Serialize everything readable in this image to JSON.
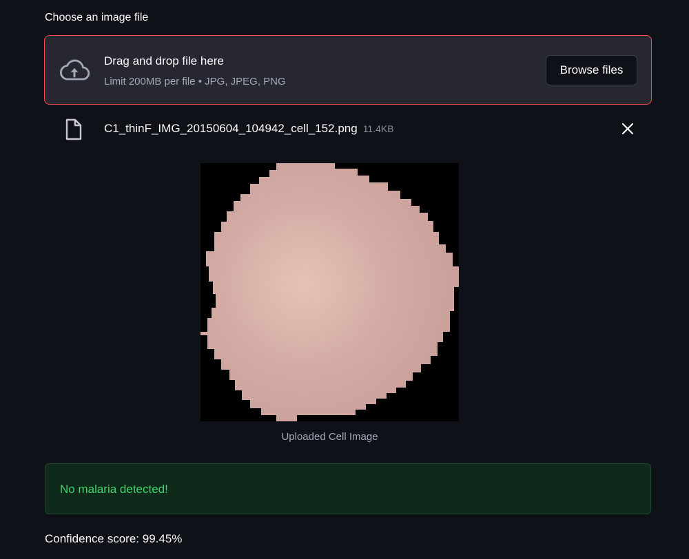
{
  "uploader": {
    "label": "Choose an image file",
    "drop_title": "Drag and drop file here",
    "drop_hint": "Limit 200MB per file • JPG, JPEG, PNG",
    "browse_label": "Browse files",
    "upload_icon": "cloud-upload-icon"
  },
  "file": {
    "name": "C1_thinF_IMG_20150604_104942_cell_152.png",
    "size": "11.4KB",
    "file_icon": "file-icon",
    "remove_icon": "close-icon"
  },
  "image": {
    "caption": "Uploaded Cell Image"
  },
  "result": {
    "message": "No malaria detected!",
    "confidence": "Confidence score: 99.45%"
  },
  "colors": {
    "background": "#0e1117",
    "dropzone_bg": "#262730",
    "dropzone_border": "#ff4b4b",
    "success_bg": "#0f2a1a",
    "success_text": "#3dd56d",
    "cell_color": "#d3aba4"
  }
}
